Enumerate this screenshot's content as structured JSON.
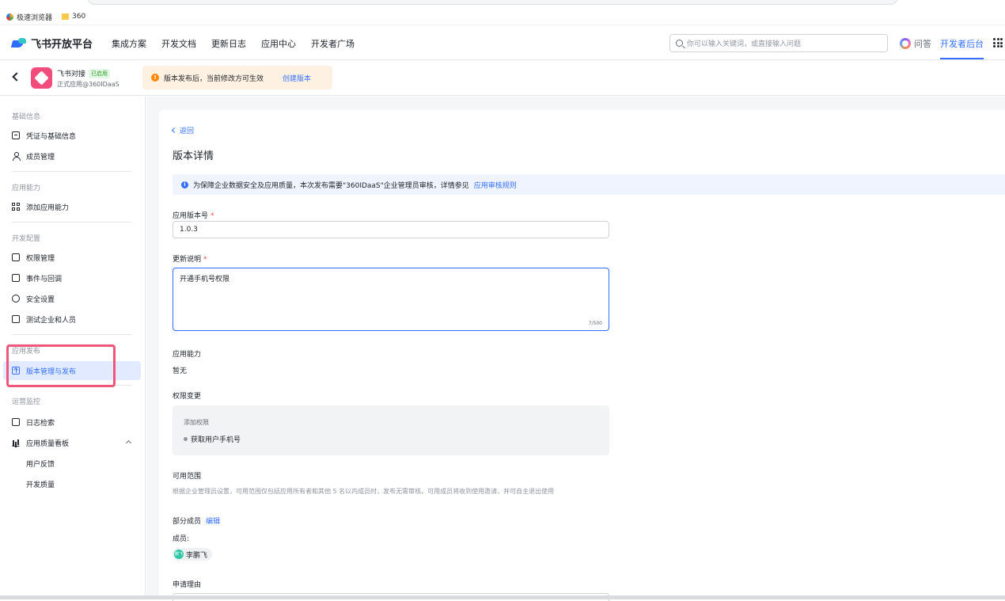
{
  "browser": {
    "bookmarks": [
      {
        "label": "极速浏览器",
        "icon": "browser-360-icon"
      },
      {
        "label": "360",
        "icon": "folder-icon"
      }
    ]
  },
  "topnav": {
    "logo": "飞书开放平台",
    "links": [
      "集成方案",
      "开发文档",
      "更新日志",
      "应用中心",
      "开发者广场"
    ],
    "search_placeholder": "你可以输入关键词，或直接输入问题",
    "ask_label": "问答",
    "console_label": "开发者后台"
  },
  "appbar": {
    "app_name": "飞书对接",
    "badge": "已启用",
    "app_sub": "正式应用@360IDaaS",
    "notice": "版本发布后，当前修改方可生效",
    "notice_link": "创建版本"
  },
  "sidebar": {
    "sections": [
      {
        "title": "基础信息",
        "items": [
          "凭证与基础信息",
          "成员管理"
        ]
      },
      {
        "title": "应用能力",
        "items": [
          "添加应用能力"
        ]
      },
      {
        "title": "开发配置",
        "items": [
          "权限管理",
          "事件与回调",
          "安全设置",
          "测试企业和人员"
        ]
      },
      {
        "title": "应用发布",
        "items": [
          "版本管理与发布"
        ]
      },
      {
        "title": "运营监控",
        "items": [
          "日志检索",
          "应用质量看板",
          "用户反馈",
          "开发质量"
        ]
      }
    ]
  },
  "main": {
    "back_label": "返回",
    "title": "版本详情",
    "info_text": "为保障企业数据安全及应用质量，本次发布需要\"360IDaaS\"企业管理员审核，详情参见",
    "info_link": "应用审核规则",
    "version_label": "应用版本号",
    "version_value": "1.0.3",
    "notes_label": "更新说明",
    "notes_value": "开通手机号权限",
    "notes_count": "7/500",
    "capability_label": "应用能力",
    "capability_value": "暂无",
    "perm_label": "权限变更",
    "perm_sub": "添加权限",
    "perm_item": "获取用户手机号",
    "scope_label": "可用范围",
    "scope_desc": "根据企业管理员设置，可用范围仅包括应用所有者和其他 5 名以内成员时，发布无需审核。可用成员将收到使用邀请，并可自主退出使用",
    "scope_part": "部分成员",
    "scope_edit": "编辑",
    "members_label": "成员:",
    "member_avatar": "鹏飞",
    "member_name": "李鹏飞",
    "reason_label": "申请理由"
  }
}
